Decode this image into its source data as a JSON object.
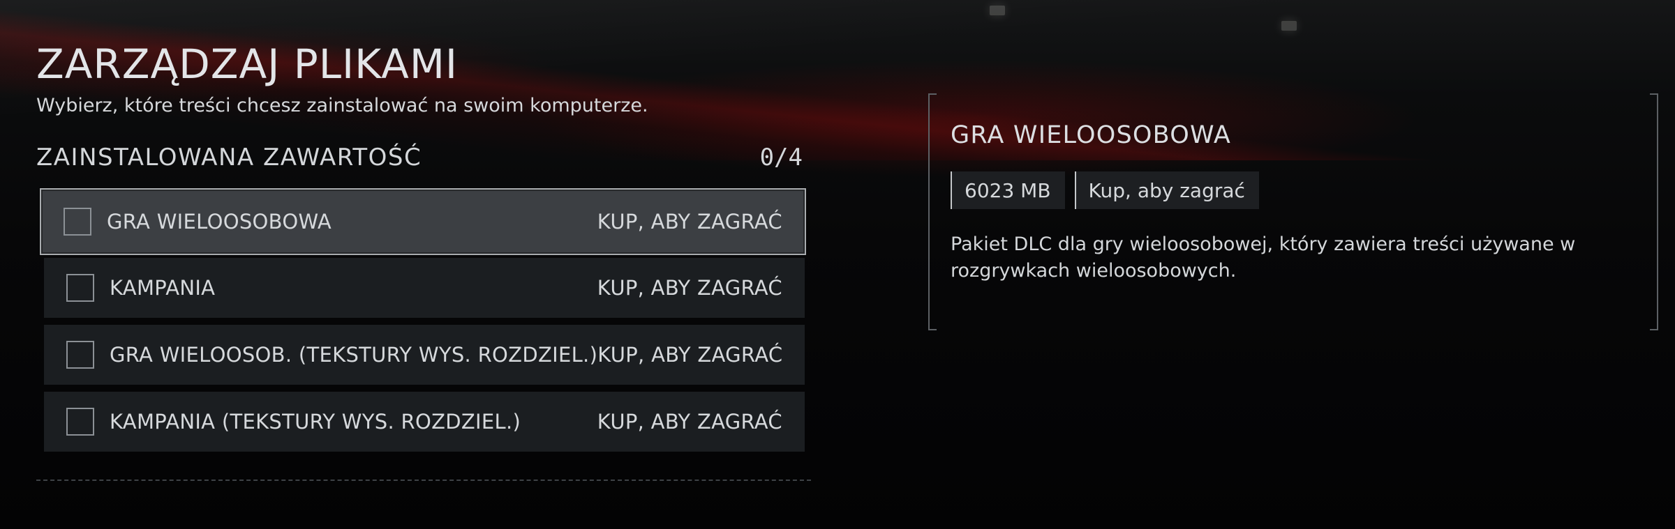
{
  "page": {
    "title": "ZARZĄDZAJ PLIKAMI",
    "subtitle": "Wybierz, które treści chcesz zainstalować na swoim komputerze."
  },
  "installed": {
    "section_title": "ZAINSTALOWANA ZAWARTOŚĆ",
    "count": "0/4",
    "items": [
      {
        "label": "GRA WIELOOSOBOWA",
        "status": "KUP, ABY ZAGRAĆ",
        "checked": false,
        "selected": true
      },
      {
        "label": "KAMPANIA",
        "status": "KUP, ABY ZAGRAĆ",
        "checked": false,
        "selected": false
      },
      {
        "label": "GRA WIELOOSOB. (TEKSTURY WYS. ROZDZIEL.)",
        "status": "KUP, ABY ZAGRAĆ",
        "checked": false,
        "selected": false
      },
      {
        "label": "KAMPANIA (TEKSTURY WYS. ROZDZIEL.)",
        "status": "KUP, ABY ZAGRAĆ",
        "checked": false,
        "selected": false
      }
    ]
  },
  "detail": {
    "title": "GRA WIELOOSOBOWA",
    "size": "6023 MB",
    "availability": "Kup, aby zagrać",
    "description": "Pakiet DLC dla gry wieloosobowej, który zawiera treści używane w rozgrywkach wieloosobowych."
  },
  "colors": {
    "background": "#050506",
    "item_background": "#1b1e21",
    "item_selected_background": "#3c3f43",
    "selected_border": "#a9acaf",
    "text": "#d6d9dc",
    "accent_red": "#5a0a0a"
  }
}
